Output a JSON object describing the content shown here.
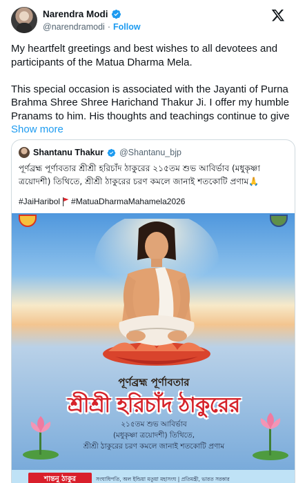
{
  "author": {
    "name": "Narendra Modi",
    "handle": "@narendramodi",
    "separator": "·",
    "follow_label": "Follow",
    "verified_icon": "verified-badge-icon",
    "platform_icon": "x-logo-icon"
  },
  "tweet": {
    "text": "My heartfelt greetings and best wishes to all devotees and participants of the Matua Dharma Mela.\n\nThis special occasion is associated with the Jayanti of Purna Brahma Shree Shree Harichand Thakur Ji. I offer my humble Pranams to him. His thoughts and teachings continue to give ",
    "show_more": "Show more"
  },
  "quote": {
    "name": "Shantanu Thakur",
    "handle": "@Shantanu_bjp",
    "text": "পূর্ণব্রহ্ম পূর্ণাবতার শ্রীশ্রী হরিচাঁদ ঠাকুরের ২১৫তম শুভ আবির্ভাব (মধুকৃষ্ণা ত্রয়োদশী) তিথিতে, শ্রীশ্রী ঠাকুরের চরণ কমলে জানাই শতকোটি প্রণাম🙏",
    "hashtag1": "#JaiHaribol",
    "hashtag2": "#MatuaDharmaMahamela2026",
    "flag_icon": "red-flag-icon"
  },
  "poster": {
    "line1": "পূর্ণব্রহ্ম পূর্ণাবতার",
    "title": "শ্রীশ্রী হরিচাঁদ ঠাকুরের",
    "sub1": "২১৫তম শুভ আবির্ভাব",
    "sub2": "(মধুকৃষ্ণা ত্রয়োদশী) তিথিতে,",
    "sub3": "শ্রীশ্রী ঠাকুরের চরণ কমলে জানাই শতকোটি প্রণাম",
    "badge": "শান্তনু ঠাকুর",
    "footer": "সংঘাধিপতি, অল ইন্ডিয়া মতুয়া মহাসংঘ | প্রতিমন্ত্রী, ভারত সরকার"
  },
  "colors": {
    "accent": "#1d9bf0",
    "verified": "#1d9bf0",
    "title_red": "#d6232a"
  }
}
